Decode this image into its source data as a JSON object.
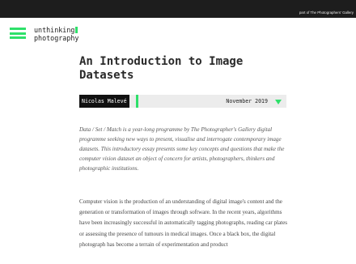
{
  "header": {
    "gallery_link": "part of The Photographers' Gallery"
  },
  "logo": {
    "line1": "unthinking",
    "line2": "photography"
  },
  "article": {
    "title": "An Introduction to Image Datasets",
    "author": "Nicolas Malevé",
    "date": "November 2019",
    "intro": "Data / Set / Match is a year-long programme by The Photographer's Gallery digital programme seeking new ways to present, visualise and interrogate contemporary image datasets. This introductory essay presents some key concepts and questions that make the computer vision dataset an object of concern for artists, photographers, thinkers and photographic institutions.",
    "body": "Computer vision is the production of an understanding of digital image's content and the generation or transformation of images through software. In the recent years, algorithms have been increasingly successful in automatically tagging photographs, reading car plates or assessing the presence of tumours in medical images. Once a black box, the digital photograph has become a terrain of experimentation and product"
  },
  "colors": {
    "accent": "#2ee06a",
    "topbar": "#1d1d1d",
    "metabar": "#ececec"
  }
}
